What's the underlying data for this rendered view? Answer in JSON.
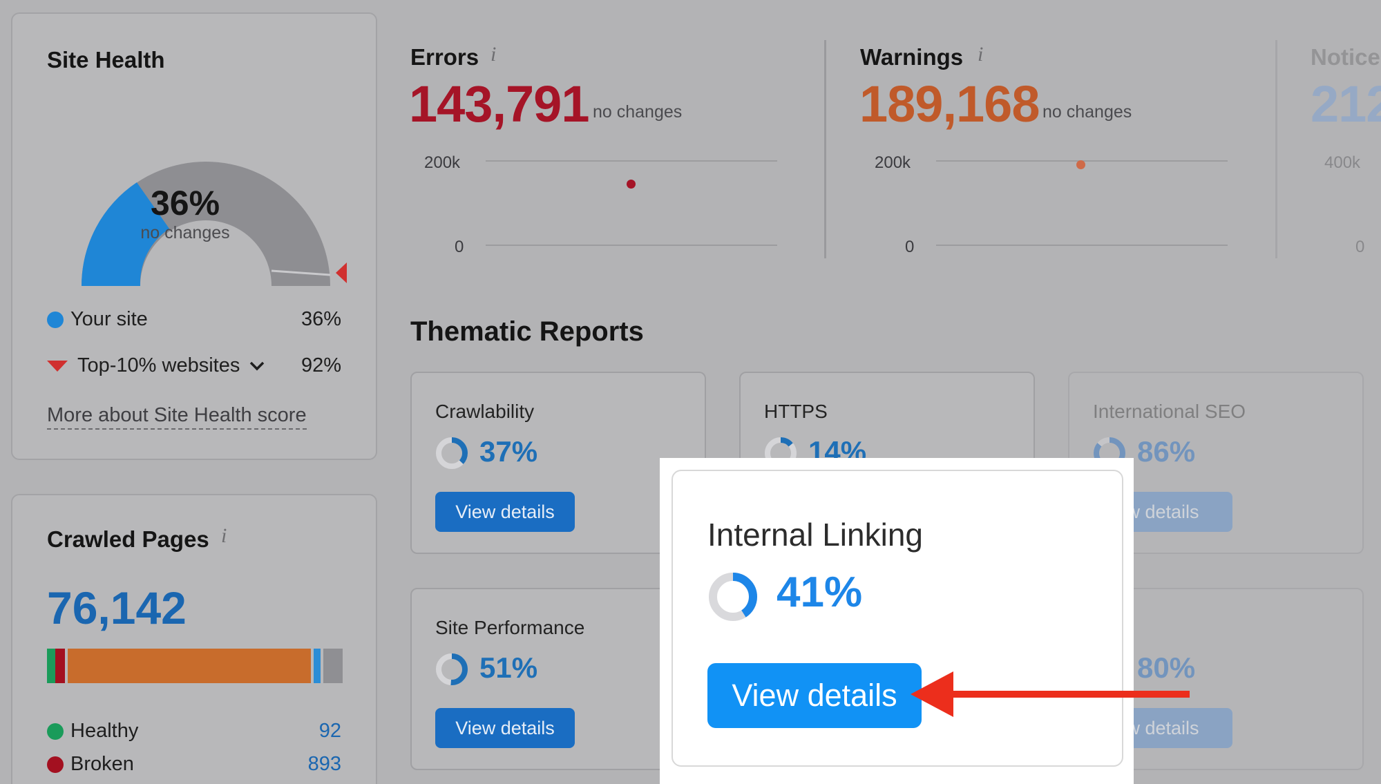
{
  "site_health": {
    "title": "Site Health",
    "percent": "36%",
    "change": "no changes",
    "your_site_label": "Your site",
    "your_site_value": "36%",
    "top10_label": "Top-10% websites",
    "top10_value": "92%",
    "more_link": "More about Site Health score",
    "gauge_fraction": 0.36,
    "top10_fraction": 0.92,
    "colors": {
      "your_site": "#1f86d6",
      "top10": "#d0302f",
      "track": "#8e8e92"
    }
  },
  "crawled_pages": {
    "title": "Crawled Pages",
    "info_icon": "info-icon",
    "total": "76,142",
    "healthy_label": "Healthy",
    "healthy_value": "92",
    "broken_label": "Broken",
    "broken_value": "893",
    "colors": {
      "healthy": "#1a9b5a",
      "broken": "#a31020",
      "redirect": "#c86c2c",
      "blocked": "#2b8dd6",
      "other": "#8f8f93"
    }
  },
  "errors": {
    "title": "Errors",
    "info_icon": "info-icon",
    "value": "143,791",
    "change": "no changes",
    "y_top": "200k",
    "y_bottom": "0",
    "color": "#a51427"
  },
  "warnings": {
    "title": "Warnings",
    "info_icon": "info-icon",
    "value": "189,168",
    "change": "no changes",
    "y_top": "200k",
    "y_bottom": "0",
    "color": "#c05a2a"
  },
  "notices": {
    "title": "Notice",
    "value": "212",
    "y_top": "400k",
    "y_bottom": "0"
  },
  "thematic": {
    "heading": "Thematic Reports",
    "reports": [
      {
        "name": "Crawlability",
        "percent": "37%",
        "button": "View details"
      },
      {
        "name": "HTTPS",
        "percent": "14%",
        "button": "View details"
      },
      {
        "name": "International SEO",
        "percent": "86%",
        "button": "w details"
      },
      {
        "name": "Site Performance",
        "percent": "51%",
        "button": "View details"
      },
      {
        "name": "kup",
        "percent": "80%",
        "button": "w details"
      }
    ],
    "highlight": {
      "name": "Internal Linking",
      "percent": "41%",
      "button": "View details"
    }
  },
  "annotation": {
    "arrow_color": "#ec2e1c"
  }
}
